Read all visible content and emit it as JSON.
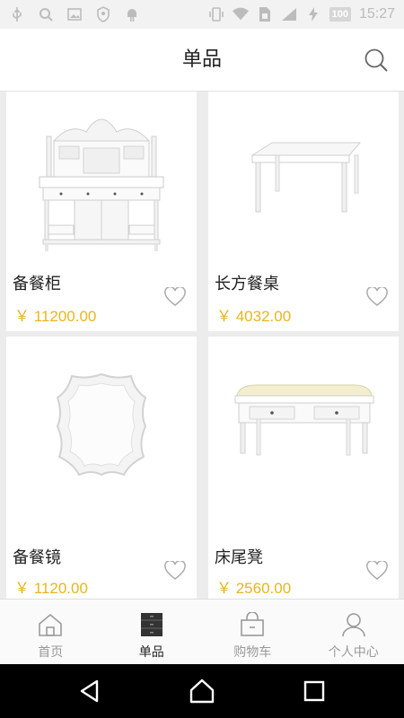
{
  "status_bar": {
    "battery": "100",
    "time": "15:27"
  },
  "header": {
    "title": "单品"
  },
  "products": [
    {
      "name": "备餐柜",
      "price": "￥ 11200.00"
    },
    {
      "name": "长方餐桌",
      "price": "￥ 4032.00"
    },
    {
      "name": "备餐镜",
      "price": "￥ 1120.00"
    },
    {
      "name": "床尾凳",
      "price": "￥ 2560.00"
    }
  ],
  "tabs": [
    {
      "label": "首页",
      "icon": "home-icon"
    },
    {
      "label": "单品",
      "icon": "cabinet-icon",
      "active": true
    },
    {
      "label": "购物车",
      "icon": "shopping-bag-icon"
    },
    {
      "label": "个人中心",
      "icon": "person-icon"
    }
  ],
  "colors": {
    "price": "#e8b51d",
    "active_tab": "#222222",
    "inactive_tab": "#999999"
  }
}
